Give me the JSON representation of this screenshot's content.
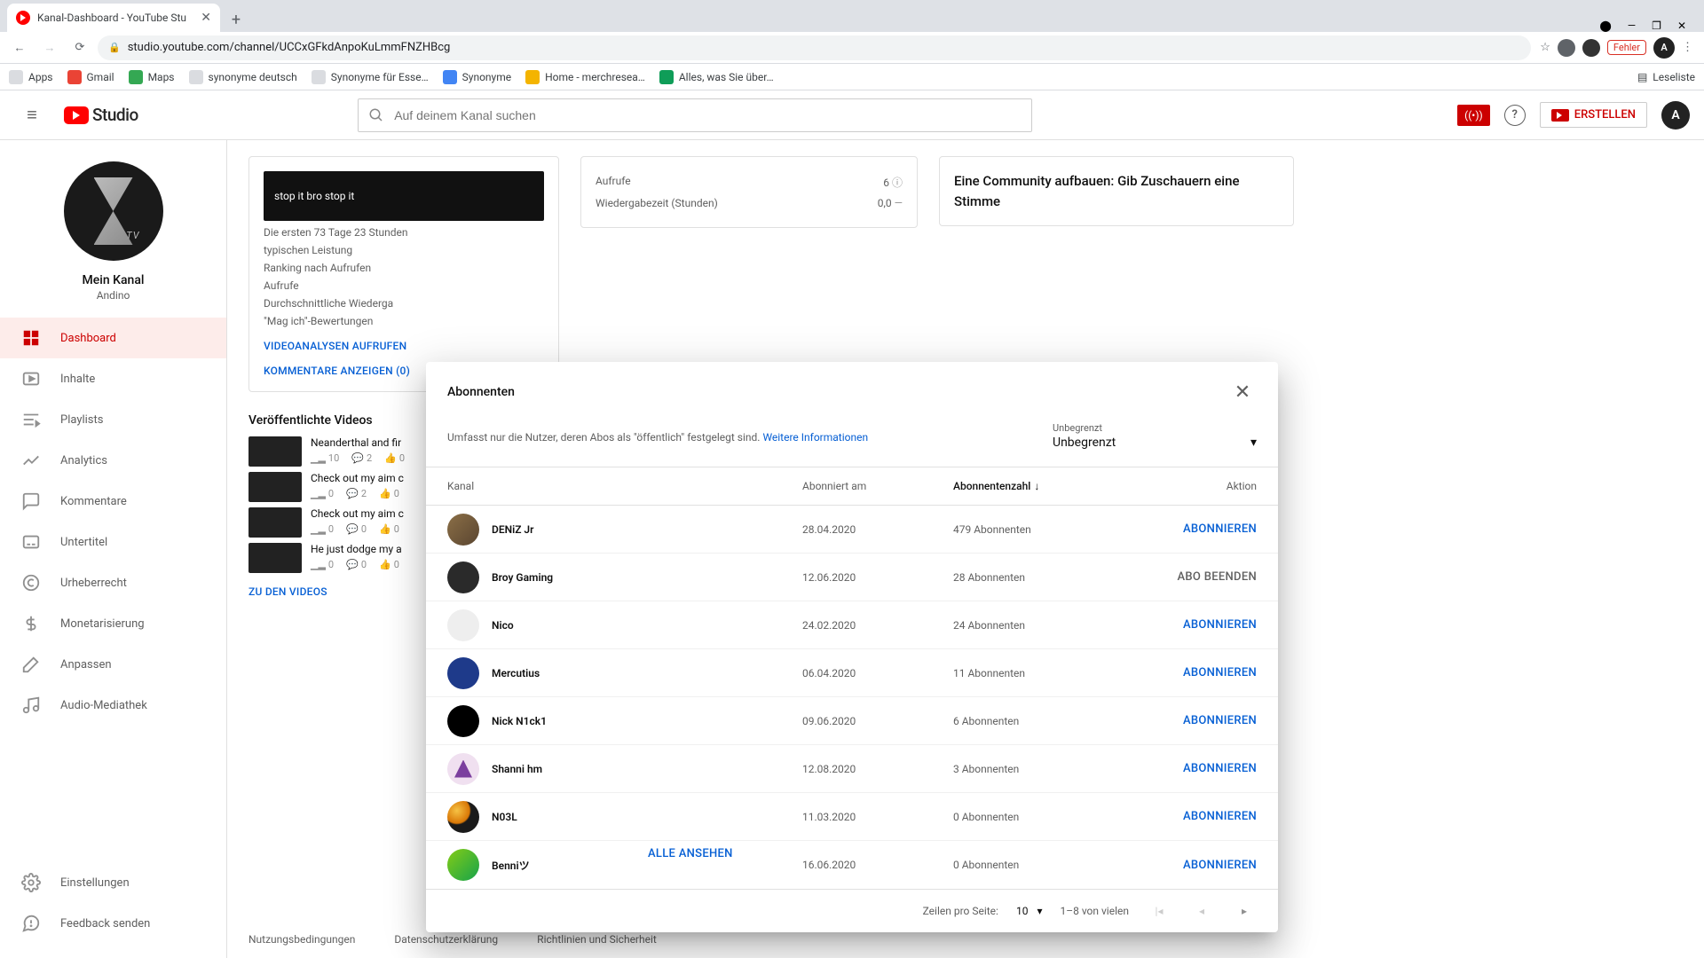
{
  "browser": {
    "tab_title": "Kanal-Dashboard - YouTube Stu",
    "url": "studio.youtube.com/channel/UCCxGFkdAnpoKuLmmFNZHBcg",
    "fehler": "Fehler",
    "leseliste": "Leseliste",
    "bookmarks": [
      "Apps",
      "Gmail",
      "Maps",
      "synonyme deutsch",
      "Synonyme für Esse…",
      "Synonyme",
      "Home - merchresea…",
      "Alles, was Sie über…"
    ]
  },
  "header": {
    "logo": "Studio",
    "search_placeholder": "Auf deinem Kanal suchen",
    "erstellen": "ERSTELLEN"
  },
  "sidebar": {
    "channel_label": "Mein Kanal",
    "channel_name": "Andino",
    "items": [
      {
        "label": "Dashboard",
        "active": true
      },
      {
        "label": "Inhalte"
      },
      {
        "label": "Playlists"
      },
      {
        "label": "Analytics"
      },
      {
        "label": "Kommentare"
      },
      {
        "label": "Untertitel"
      },
      {
        "label": "Urheberrecht"
      },
      {
        "label": "Monetarisierung"
      },
      {
        "label": "Anpassen"
      },
      {
        "label": "Audio-Mediathek"
      }
    ],
    "bottom": [
      {
        "label": "Einstellungen"
      },
      {
        "label": "Feedback senden"
      }
    ]
  },
  "bg": {
    "thumb_caption": "stop it bro stop it",
    "line1": "Die ersten 73 Tage 23 Stunden",
    "line2": "typischen Leistung",
    "stats": [
      "Ranking nach Aufrufen",
      "Aufrufe",
      "Durchschnittliche Wiederga",
      "\"Mag ich\"-Bewertungen"
    ],
    "linkA": "VIDEOANALYSEN AUFRUFEN",
    "linkB": "KOMMENTARE ANZEIGEN (0)",
    "mid_rows": [
      {
        "k": "Aufrufe",
        "v": "6"
      },
      {
        "k": "Wiedergabezeit (Stunden)",
        "v": "0,0"
      }
    ],
    "right_title": "Eine Community aufbauen: Gib Zuschauern eine Stimme",
    "pub_title": "Veröffentlichte Videos",
    "videos": [
      {
        "t": "Neanderthal and fir",
        "v": "10",
        "l": "2",
        "c": "0"
      },
      {
        "t": "Check out my aim c",
        "v": "0",
        "l": "2",
        "c": "0"
      },
      {
        "t": "Check out my aim c",
        "v": "0",
        "l": "0",
        "c": "0"
      },
      {
        "t": "He just dodge my a",
        "v": "0",
        "l": "0",
        "c": "0"
      }
    ],
    "zu_videos": "ZU DEN VIDEOS",
    "alle_ansehen": "ALLE ANSEHEN",
    "footer": [
      "Nutzungsbedingungen",
      "Datenschutzerklärung",
      "Richtlinien und Sicherheit"
    ]
  },
  "dialog": {
    "title": "Abonnenten",
    "desc": "Umfasst nur die Nutzer, deren Abos als \"öffentlich\" festgelegt sind.",
    "more": "Weitere Informationen",
    "filter_label": "Unbegrenzt",
    "filter_value": "Unbegrenzt",
    "cols": {
      "kanal": "Kanal",
      "date": "Abonniert am",
      "subs": "Abonnentenzahl",
      "action": "Aktion"
    },
    "rows": [
      {
        "name": "DENiZ Jr",
        "date": "28.04.2020",
        "subs": "479 Abonnenten",
        "action": "ABONNIEREN",
        "cls": "av0"
      },
      {
        "name": "Broy Gaming",
        "date": "12.06.2020",
        "subs": "28 Abonnenten",
        "action": "ABO BEENDEN",
        "cls": "av1",
        "grey": true
      },
      {
        "name": "Nico",
        "date": "24.02.2020",
        "subs": "24 Abonnenten",
        "action": "ABONNIEREN",
        "cls": "av2"
      },
      {
        "name": "Mercutius",
        "date": "06.04.2020",
        "subs": "11 Abonnenten",
        "action": "ABONNIEREN",
        "cls": "av3"
      },
      {
        "name": "Nick N1ck1",
        "date": "09.06.2020",
        "subs": "6 Abonnenten",
        "action": "ABONNIEREN",
        "cls": "av4"
      },
      {
        "name": "Shanni hm",
        "date": "12.08.2020",
        "subs": "3 Abonnenten",
        "action": "ABONNIEREN",
        "cls": "av5"
      },
      {
        "name": "N03L",
        "date": "11.03.2020",
        "subs": "0 Abonnenten",
        "action": "ABONNIEREN",
        "cls": "av6"
      },
      {
        "name": "Benniツ",
        "date": "16.06.2020",
        "subs": "0 Abonnenten",
        "action": "ABONNIEREN",
        "cls": "av7"
      }
    ],
    "rows_per_page_label": "Zeilen pro Seite:",
    "rows_per_page": "10",
    "range": "1–8 von vielen"
  }
}
